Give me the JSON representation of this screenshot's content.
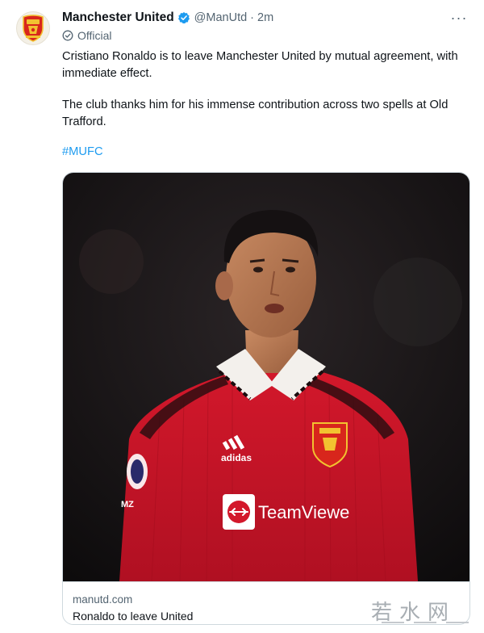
{
  "account": {
    "name": "Manchester United",
    "handle": "@ManUtd",
    "separator": "·",
    "time": "2m",
    "label": "Official",
    "avatar_icon": "manchester-united-crest",
    "verified_icon": "verified-badge",
    "verified_color": "#1d9bf0"
  },
  "menu": {
    "icon": "more-options-icon",
    "glyph": "···"
  },
  "tweet": {
    "paragraph_1": "Cristiano Ronaldo is to leave Manchester United by mutual agreement, with immediate effect.",
    "paragraph_2": "The club thanks him for his immense contribution across two spells at Old Trafford.",
    "hashtag": "#MUFC",
    "hashtag_color": "#1d9bf0"
  },
  "link_card": {
    "domain": "manutd.com",
    "title": "Ronaldo to leave United",
    "image": {
      "sleeve_patch": "MZ",
      "sponsor_text": "TeamViewe",
      "kit_brand": "adidas",
      "kit_color": "#c8102e"
    }
  },
  "watermark": {
    "text": "若水网"
  }
}
